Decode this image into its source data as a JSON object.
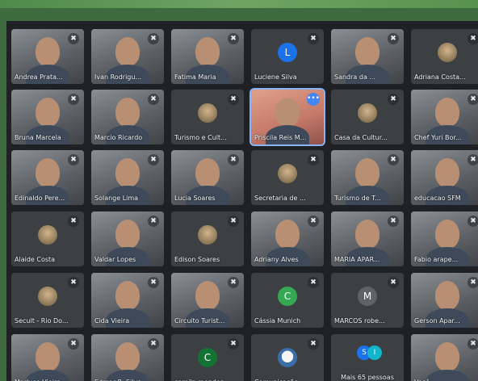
{
  "participants": [
    {
      "name": "Andrea Prata...",
      "kind": "video",
      "muted": true
    },
    {
      "name": "Ivan Rodrigu...",
      "kind": "video",
      "muted": true
    },
    {
      "name": "Fatima Maria",
      "kind": "video",
      "muted": true
    },
    {
      "name": "Luciene Silva",
      "kind": "avatar",
      "initial": "L",
      "color": "#1a73e8",
      "muted": true
    },
    {
      "name": "Sandra da ...",
      "kind": "video",
      "muted": true
    },
    {
      "name": "Adriana Costa...",
      "kind": "avatar-photo",
      "muted": true
    },
    {
      "name": "Bruna Marcela",
      "kind": "video",
      "muted": true
    },
    {
      "name": "Marcio Ricardo",
      "kind": "video",
      "muted": true
    },
    {
      "name": "Turismo e Cult...",
      "kind": "avatar-photo",
      "muted": true
    },
    {
      "name": "Priscila Reis M...",
      "kind": "video-active",
      "muted": false
    },
    {
      "name": "Casa da Cultur...",
      "kind": "avatar-photo",
      "muted": true
    },
    {
      "name": "Chef Yuri Bor...",
      "kind": "video",
      "muted": true
    },
    {
      "name": "Edinaldo Pere...",
      "kind": "video",
      "muted": true
    },
    {
      "name": "Solange Lima",
      "kind": "video",
      "muted": true
    },
    {
      "name": "Lucia Soares",
      "kind": "video",
      "muted": true
    },
    {
      "name": "Secretaria de ...",
      "kind": "avatar-photo",
      "muted": true
    },
    {
      "name": "Turismo de T...",
      "kind": "video",
      "muted": true
    },
    {
      "name": "educacao SFM",
      "kind": "video",
      "muted": true
    },
    {
      "name": "Alaide Costa",
      "kind": "avatar-photo",
      "muted": true
    },
    {
      "name": "Valdar Lopes",
      "kind": "video",
      "muted": true
    },
    {
      "name": "Edison Soares",
      "kind": "avatar-photo",
      "muted": true
    },
    {
      "name": "Adriany Alves",
      "kind": "video",
      "muted": true
    },
    {
      "name": "MARIA APAR...",
      "kind": "video",
      "muted": true
    },
    {
      "name": "Fabio arape...",
      "kind": "video",
      "muted": true
    },
    {
      "name": "Secult - Rio Do...",
      "kind": "avatar-photo",
      "muted": true
    },
    {
      "name": "Cida Vieira",
      "kind": "video",
      "muted": true
    },
    {
      "name": "Circuito Turist...",
      "kind": "video",
      "muted": true
    },
    {
      "name": "Cássia Munich",
      "kind": "avatar",
      "initial": "C",
      "color": "#34a853",
      "muted": true
    },
    {
      "name": "MARCOS robe...",
      "kind": "avatar",
      "initial": "M",
      "color": "#5f6368",
      "muted": true
    },
    {
      "name": "Gerson Apar...",
      "kind": "video",
      "muted": true
    },
    {
      "name": "Marluce Vieira",
      "kind": "video",
      "muted": true
    },
    {
      "name": "Edmar R. Silva",
      "kind": "video",
      "muted": true
    },
    {
      "name": "camila mendes",
      "kind": "avatar",
      "initial": "C",
      "color": "#137333",
      "muted": true
    },
    {
      "name": "Comunicação ...",
      "kind": "avatar-logo",
      "muted": true
    },
    {
      "name": "Mais 65 pessoas",
      "kind": "more-people",
      "muted": false
    },
    {
      "name": "Você",
      "kind": "video",
      "muted": true
    }
  ],
  "more_people_initials": [
    "S",
    "I"
  ],
  "more_people_colors": [
    "#1a73e8",
    "#12b5cb"
  ],
  "icons": {
    "mic_off": "mic-off-icon",
    "more": "more-options-icon"
  }
}
